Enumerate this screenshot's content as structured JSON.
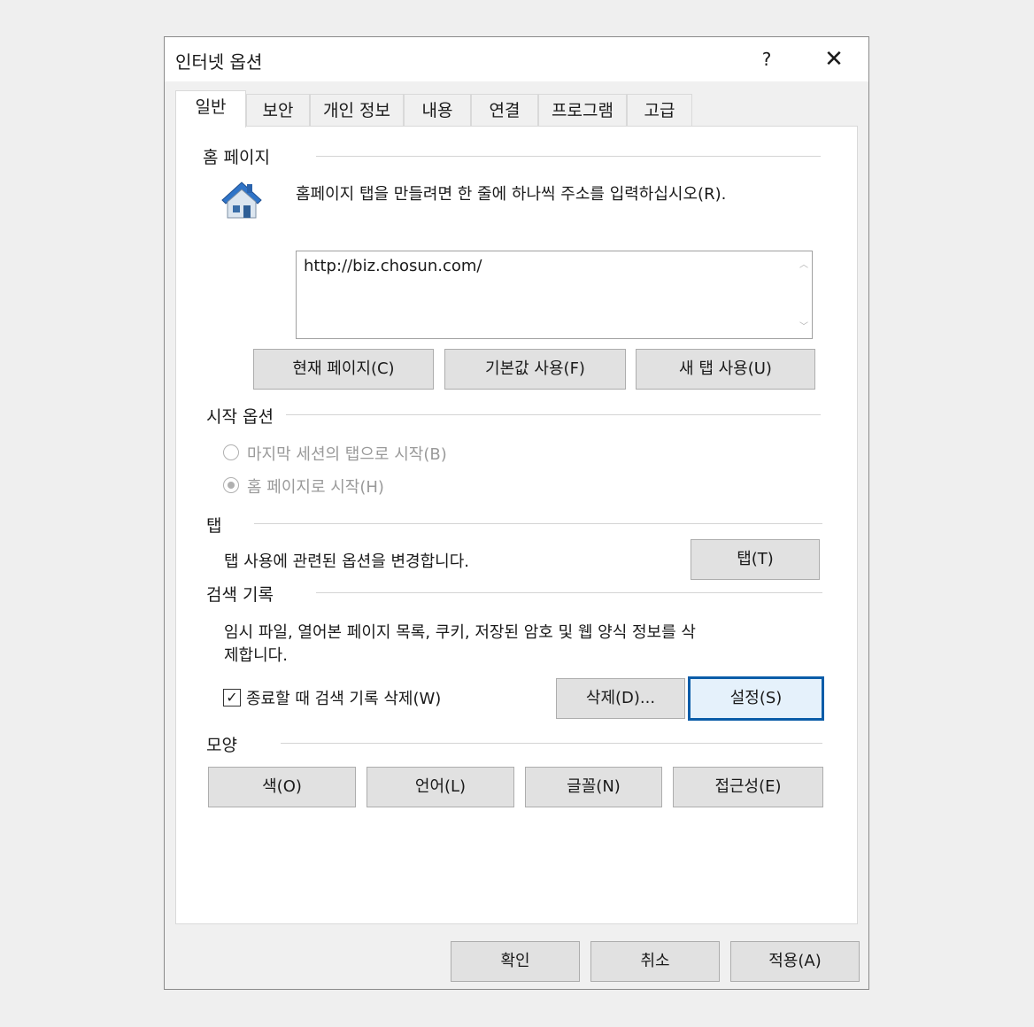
{
  "window": {
    "title": "인터넷 옵션",
    "help_label": "?",
    "close_label": "✕"
  },
  "tabs": [
    {
      "label": "일반"
    },
    {
      "label": "보안"
    },
    {
      "label": "개인 정보"
    },
    {
      "label": "내용"
    },
    {
      "label": "연결"
    },
    {
      "label": "프로그램"
    },
    {
      "label": "고급"
    }
  ],
  "homepage": {
    "title": "홈 페이지",
    "icon": "house-icon",
    "description": "홈페이지 탭을 만들려면 한 줄에 하나씩 주소를 입력하십시오(R).",
    "url_value": "http://biz.chosun.com/",
    "buttons": {
      "current": "현재 페이지(C)",
      "default": "기본값 사용(F)",
      "new_tab": "새 탭 사용(U)"
    }
  },
  "startup": {
    "title": "시작 옵션",
    "option_last_session": "마지막 세션의 탭으로 시작(B)",
    "option_homepage": "홈 페이지로 시작(H)",
    "selected": "homepage"
  },
  "tabs_section": {
    "title": "탭",
    "description": "탭 사용에 관련된 옵션을 변경합니다.",
    "button": "탭(T)"
  },
  "history": {
    "title": "검색 기록",
    "description_line1": "임시 파일, 열어본 페이지 목록, 쿠키, 저장된 암호 및 웹 양식 정보를 삭",
    "description_line2": "제합니다.",
    "checkbox_label": "종료할 때 검색 기록 삭제(W)",
    "checkbox_checked": true,
    "delete_button": "삭제(D)...",
    "settings_button": "설정(S)"
  },
  "appearance": {
    "title": "모양",
    "buttons": {
      "colors": "색(O)",
      "languages": "언어(L)",
      "fonts": "글꼴(N)",
      "accessibility": "접근성(E)"
    }
  },
  "footer": {
    "ok": "확인",
    "cancel": "취소",
    "apply": "적용(A)"
  },
  "colors": {
    "focus_border": "#0a5ca8",
    "house_roof": "#2f74c8",
    "house_wall": "#dce6f0"
  }
}
